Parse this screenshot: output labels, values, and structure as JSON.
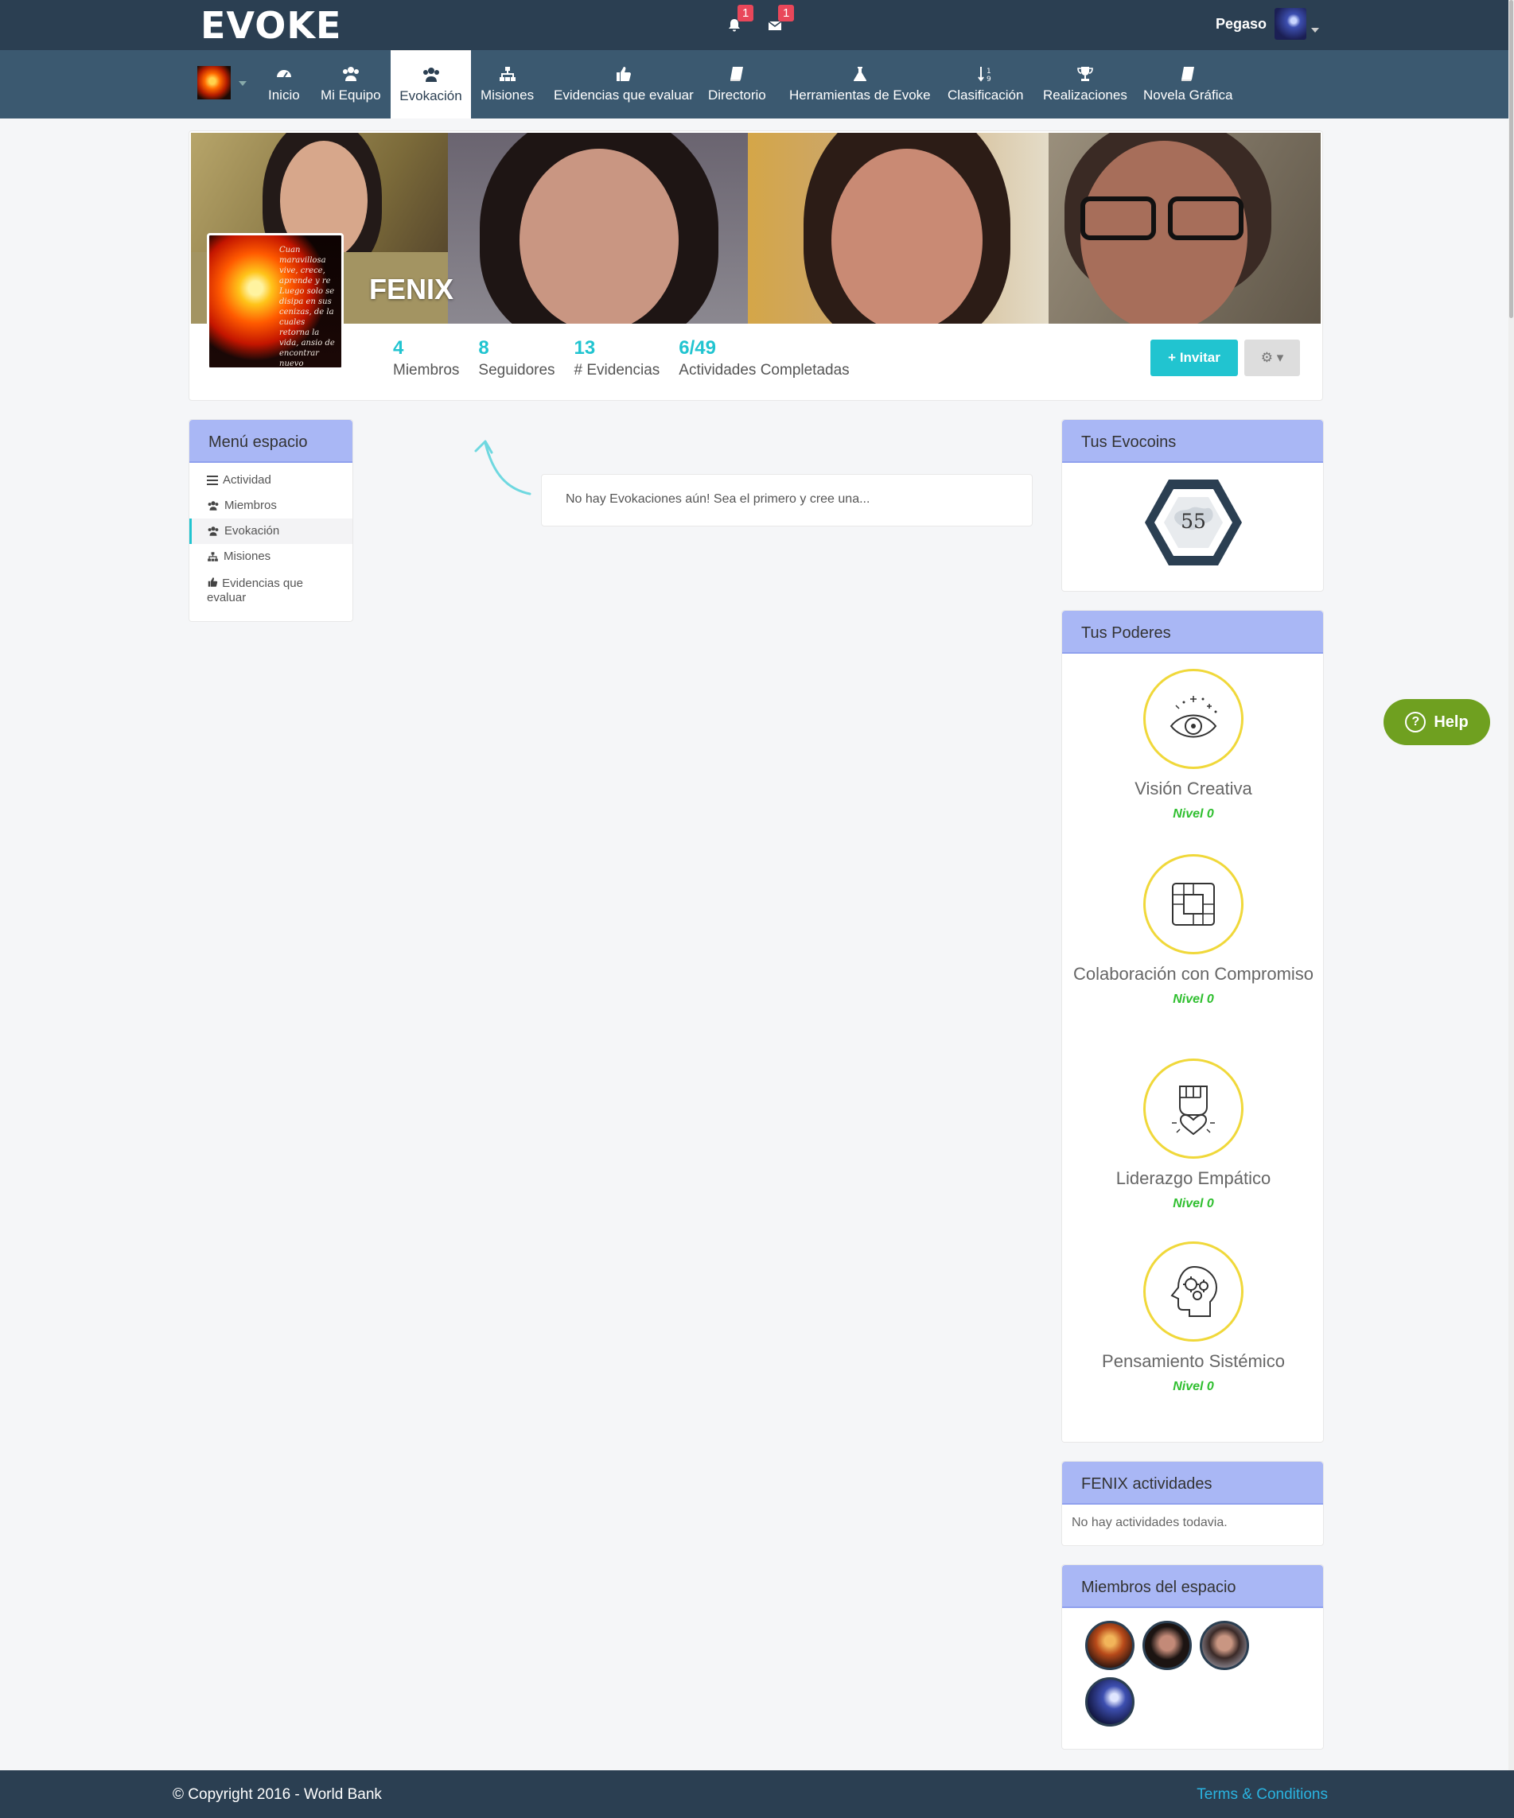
{
  "brand": {
    "logo": "EVOKE"
  },
  "topbar": {
    "notifications": {
      "icon": "bell-icon",
      "count": "1"
    },
    "messages": {
      "icon": "envelope-icon",
      "count": "1"
    },
    "user": {
      "name": "Pegaso"
    }
  },
  "nav": {
    "items": [
      {
        "label": "Inicio",
        "icon": "dashboard-icon"
      },
      {
        "label": "Mi Equipo",
        "icon": "users-icon"
      },
      {
        "label": "Evokación",
        "icon": "users-icon"
      },
      {
        "label": "Misiones",
        "icon": "sitemap-icon"
      },
      {
        "label": "Evidencias que evaluar",
        "icon": "thumbs-up-icon"
      },
      {
        "label": "Directorio",
        "icon": "book-icon"
      },
      {
        "label": "Herramientas de Evoke",
        "icon": "flask-icon"
      },
      {
        "label": "Clasificación",
        "icon": "sort-numeric-icon"
      },
      {
        "label": "Realizaciones",
        "icon": "trophy-icon"
      },
      {
        "label": "Novela Gráfica",
        "icon": "book-icon"
      }
    ],
    "active": "Evokación"
  },
  "space": {
    "name": "FENIX",
    "logo_text": "Cuan maravillosa vive, crece, aprende y re Luego solo se disipa en sus cenizas, de la cuales retorna la vida, ansio de encontrar nuevo amanecer.",
    "stats": [
      {
        "value": "4",
        "label": "Miembros"
      },
      {
        "value": "8",
        "label": "Seguidores"
      },
      {
        "value": "13",
        "label": "# Evidencias"
      },
      {
        "value": "6/49",
        "label": "Actividades Completadas"
      }
    ],
    "invite_label": "Invitar",
    "settings_label": "⚙ ▾"
  },
  "menu": {
    "title": "Menú espacio",
    "items": [
      {
        "label": "Actividad",
        "icon": "list-icon"
      },
      {
        "label": "Miembros",
        "icon": "users-icon"
      },
      {
        "label": "Evokación",
        "icon": "users-icon"
      },
      {
        "label": "Misiones",
        "icon": "sitemap-icon"
      },
      {
        "label": "Evidencias que evaluar",
        "icon": "thumbs-up-icon"
      }
    ]
  },
  "stream": {
    "empty_text": "No hay Evokaciones aún! Sea el primero y cree una..."
  },
  "evocoins": {
    "title": "Tus Evocoins",
    "value": "55"
  },
  "powers": {
    "title": "Tus Poderes",
    "items": [
      {
        "name": "Visión Creativa",
        "level": "Nivel 0",
        "icon": "eye-icon"
      },
      {
        "name": "Colaboración con Compromiso",
        "level": "Nivel 0",
        "icon": "hands-icon"
      },
      {
        "name": "Liderazgo Empático",
        "level": "Nivel 0",
        "icon": "fist-heart-icon"
      },
      {
        "name": "Pensamiento Sistémico",
        "level": "Nivel 0",
        "icon": "brain-gears-icon"
      }
    ]
  },
  "activities": {
    "title": "FENIX actividades",
    "empty_text": "No hay actividades todavia."
  },
  "members": {
    "title": "Miembros del espacio",
    "count": 4
  },
  "help": {
    "label": "Help"
  },
  "footer": {
    "copyright": "© Copyright 2016 - World Bank",
    "terms": "Terms & Conditions"
  },
  "colors": {
    "accent": "#21c4d0",
    "topbar": "#2b3f52",
    "navbar": "#3b5970",
    "panel_header": "#a9b7f5",
    "level": "#2fbf2f",
    "help": "#6fa020"
  }
}
